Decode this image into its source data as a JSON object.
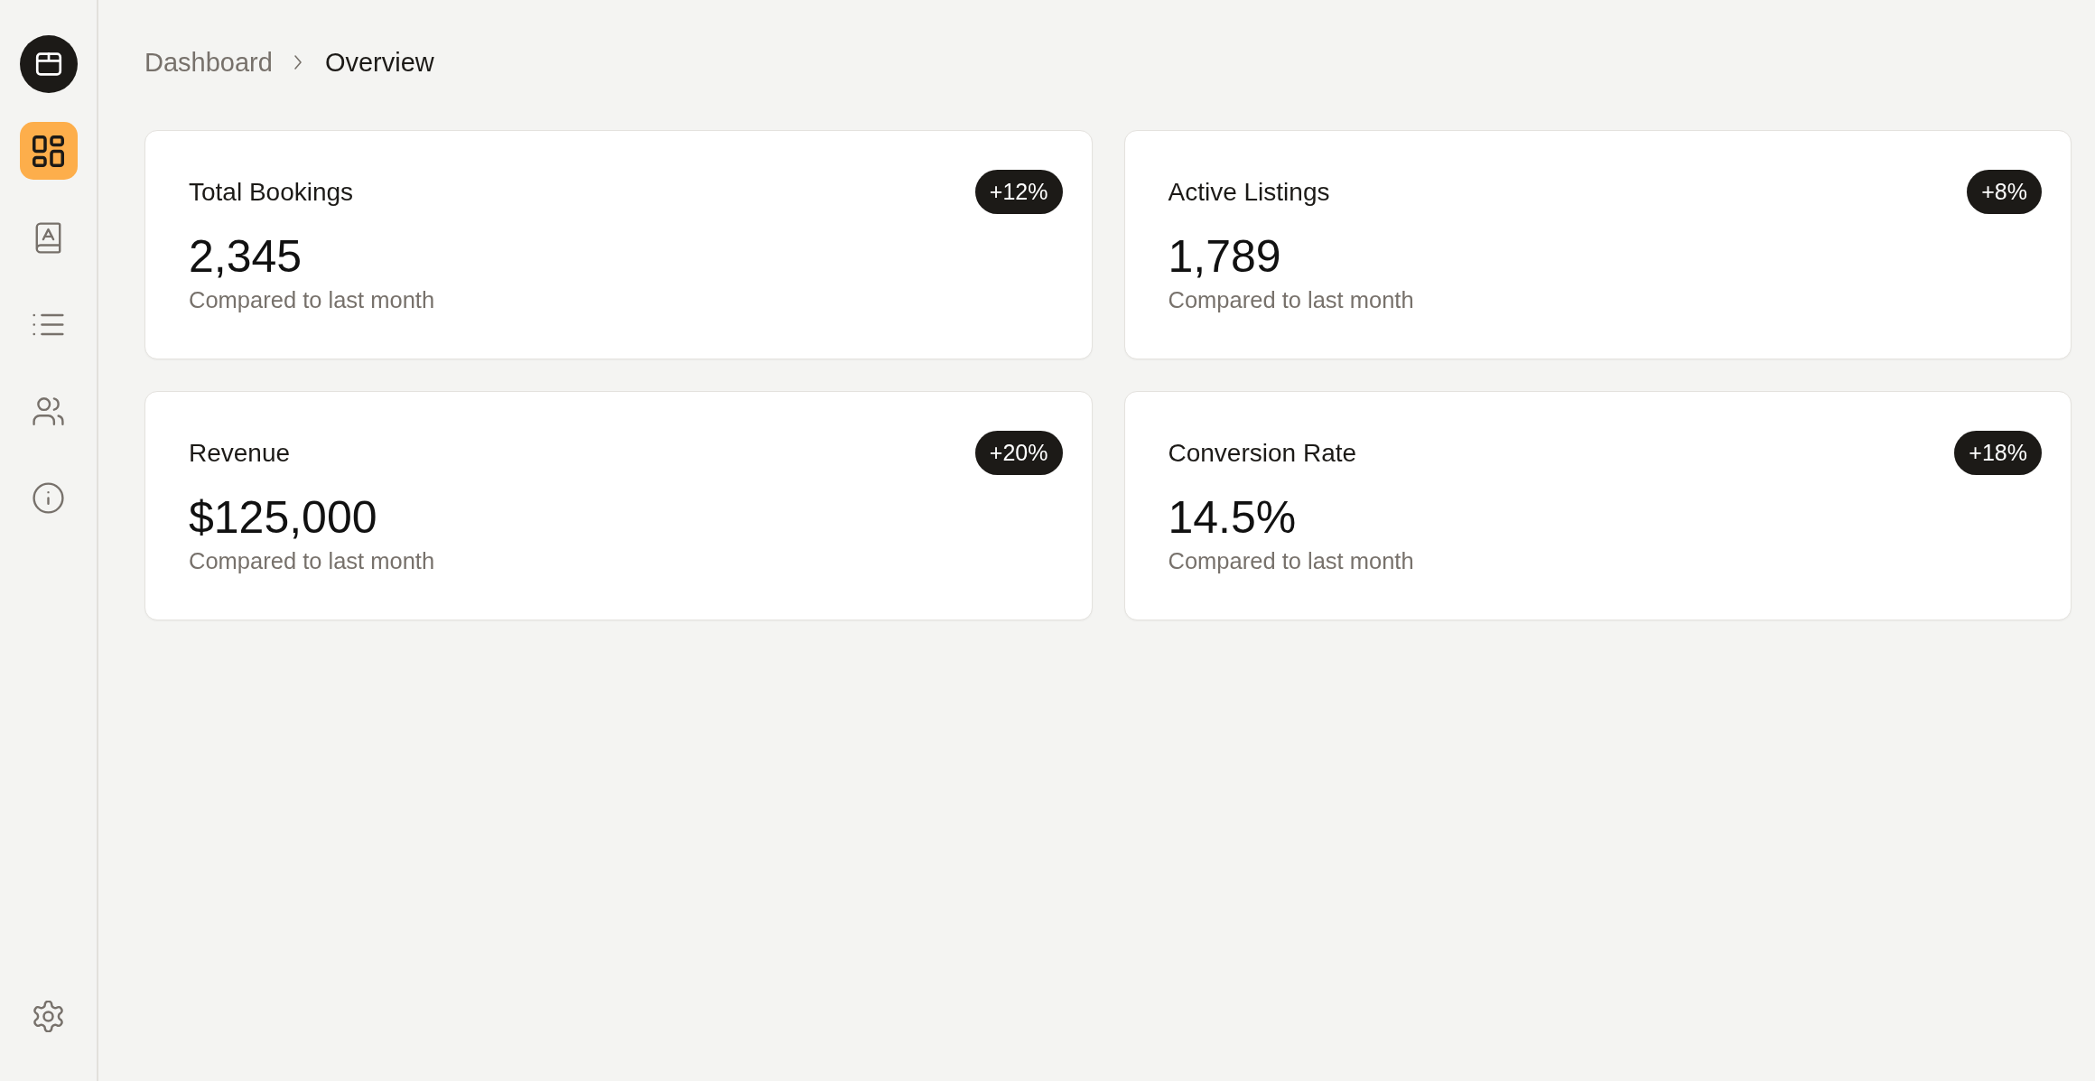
{
  "sidebar": {
    "nav": [
      {
        "selected": true
      },
      {
        "selected": false
      },
      {
        "selected": false
      },
      {
        "selected": false
      },
      {
        "selected": false
      }
    ]
  },
  "breadcrumb": [
    {
      "label": "Dashboard",
      "current": false
    },
    {
      "label": "Overview",
      "current": true
    }
  ],
  "stats": [
    {
      "title": "Total Bookings",
      "value": "2,345",
      "change": "+12%",
      "note": "Compared to last month"
    },
    {
      "title": "Active Listings",
      "value": "1,789",
      "change": "+8%",
      "note": "Compared to last month"
    },
    {
      "title": "Revenue",
      "value": "$125,000",
      "change": "+20%",
      "note": "Compared to last month"
    },
    {
      "title": "Conversion Rate",
      "value": "14.5%",
      "change": "+18%",
      "note": "Compared to last month"
    }
  ]
}
